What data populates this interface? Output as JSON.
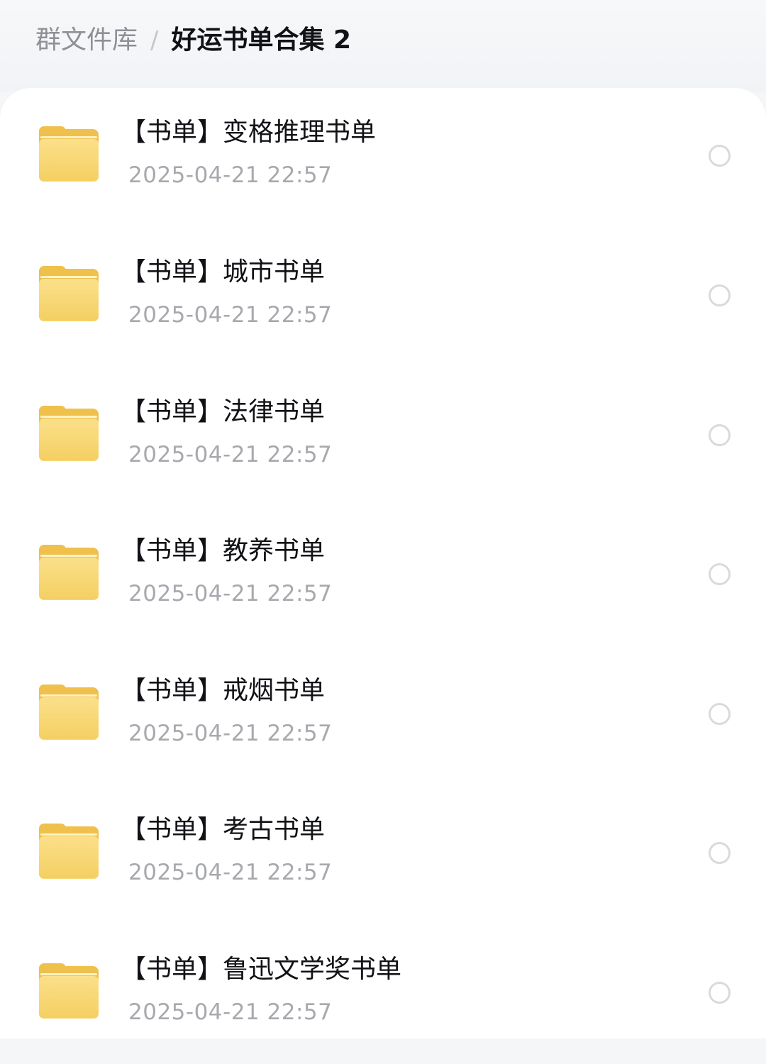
{
  "breadcrumb": {
    "root": "群文件库",
    "separator": "/",
    "current": "好运书单合集 2"
  },
  "colors": {
    "folder": "#f4cf62",
    "title": "#111216",
    "date": "#a7a9ae",
    "radio_border": "#d9dadd"
  },
  "files": [
    {
      "title": "【书单】变格推理书单",
      "date": "2025-04-21 22:57",
      "icon": "folder-icon",
      "selected": false
    },
    {
      "title": "【书单】城市书单",
      "date": "2025-04-21 22:57",
      "icon": "folder-icon",
      "selected": false
    },
    {
      "title": "【书单】法律书单",
      "date": "2025-04-21 22:57",
      "icon": "folder-icon",
      "selected": false
    },
    {
      "title": "【书单】教养书单",
      "date": "2025-04-21 22:57",
      "icon": "folder-icon",
      "selected": false
    },
    {
      "title": "【书单】戒烟书单",
      "date": "2025-04-21 22:57",
      "icon": "folder-icon",
      "selected": false
    },
    {
      "title": "【书单】考古书单",
      "date": "2025-04-21 22:57",
      "icon": "folder-icon",
      "selected": false
    },
    {
      "title": "【书单】鲁迅文学奖书单",
      "date": "2025-04-21 22:57",
      "icon": "folder-icon",
      "selected": false
    }
  ]
}
